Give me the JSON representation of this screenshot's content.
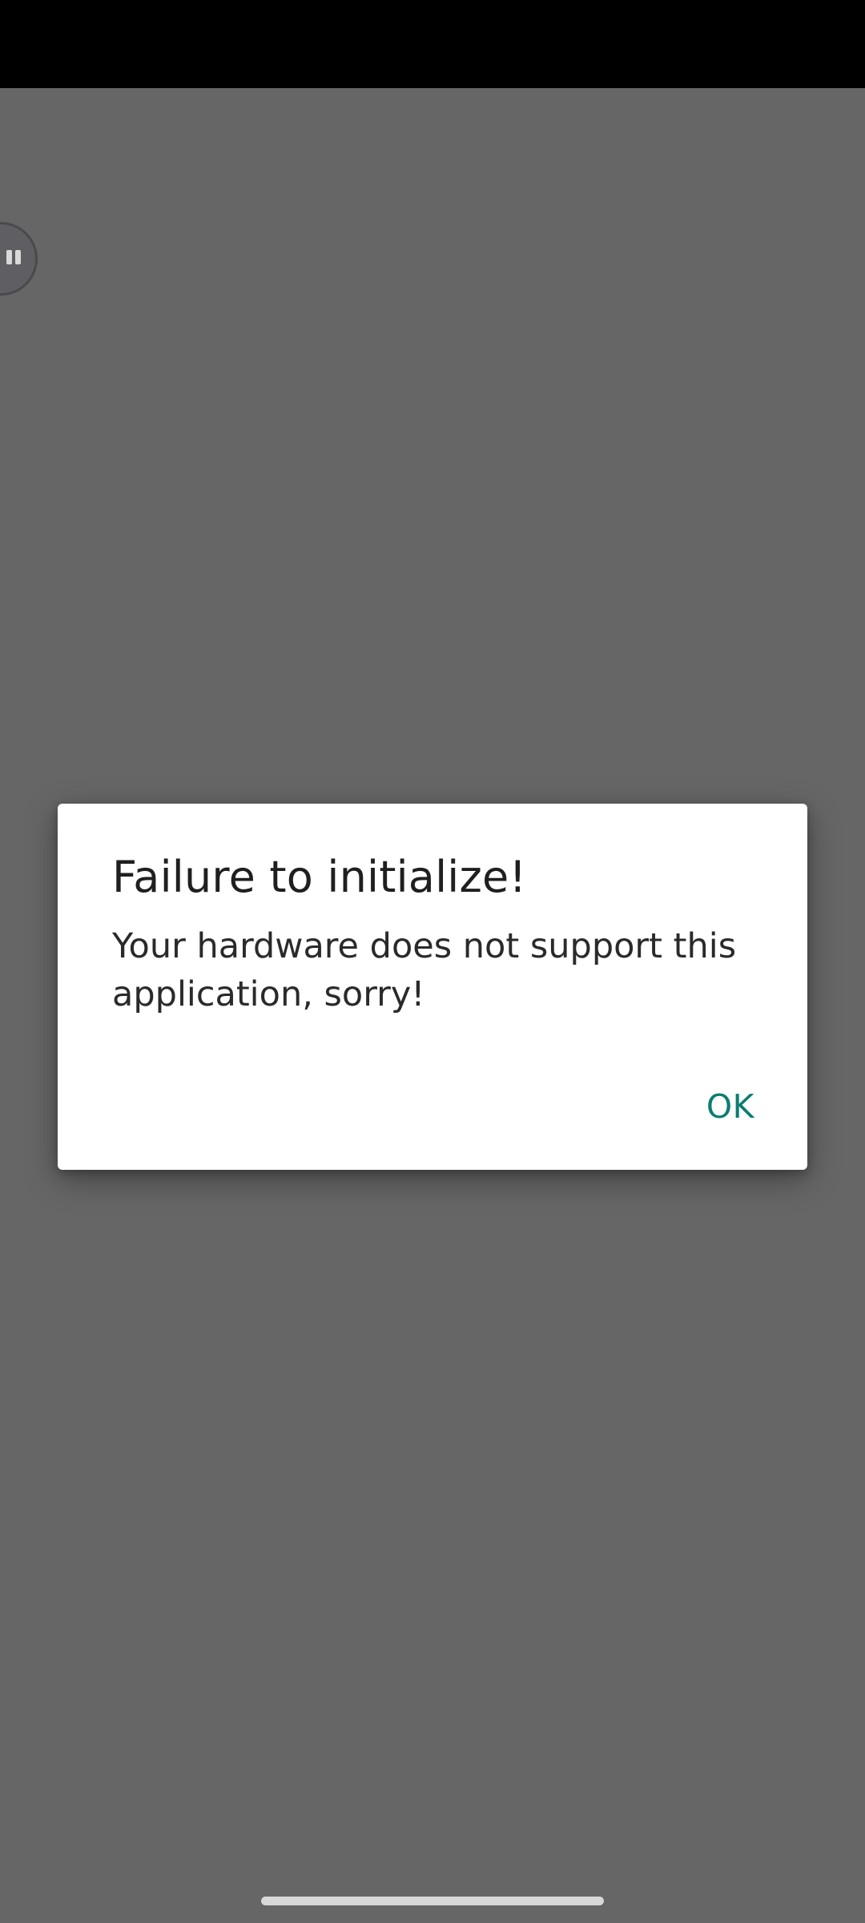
{
  "dialog": {
    "title": "Failure to initialize!",
    "message": "Your hardware does not support this application, sorry!",
    "ok_label": "OK"
  },
  "colors": {
    "background_dim": "#666666",
    "status_bar": "#000000",
    "dialog_background": "#ffffff",
    "accent": "#0b7d72"
  },
  "icons": {
    "floating_bubble": "pause-icon"
  }
}
